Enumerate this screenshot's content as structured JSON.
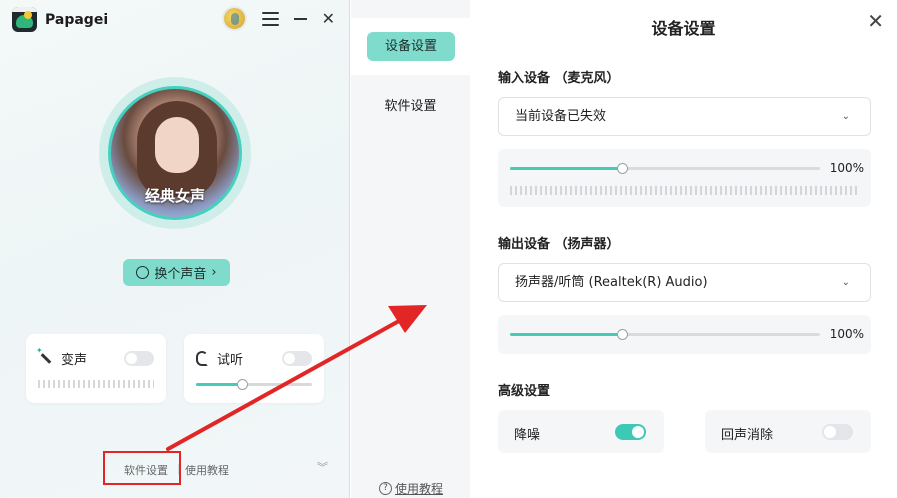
{
  "app": {
    "name": "Papagei",
    "voice_name": "经典女声",
    "swap_button": "换个声音",
    "cards": {
      "voice_change": {
        "label": "变声",
        "enabled": false
      },
      "monitor": {
        "label": "试听",
        "enabled": false,
        "volume": 0.4
      }
    },
    "footer": {
      "software_settings": "软件设置",
      "separator": "|",
      "tutorial": "使用教程"
    }
  },
  "settings": {
    "title": "设备设置",
    "sidebar": {
      "device_settings": "设备设置",
      "software_settings": "软件设置",
      "help": "使用教程"
    },
    "input": {
      "label": "输入设备 （麦克风）",
      "device": "当前设备已失效",
      "volume_text": "100%",
      "volume": 0.36
    },
    "output": {
      "label": "输出设备 （扬声器）",
      "device": "扬声器/听筒 (Realtek(R) Audio)",
      "volume_text": "100%",
      "volume": 0.36
    },
    "advanced": {
      "label": "高级设置",
      "noise_reduction": {
        "label": "降噪",
        "enabled": true
      },
      "echo_cancel": {
        "label": "回声消除",
        "enabled": false
      }
    }
  },
  "colors": {
    "accent": "#7fdccd",
    "toggle_on": "#3ccab6",
    "annotation_red": "#e22525"
  }
}
